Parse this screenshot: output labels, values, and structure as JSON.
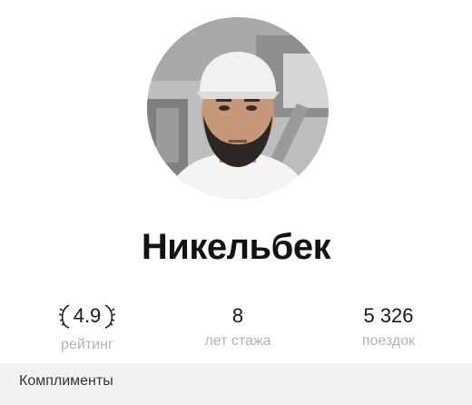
{
  "profile": {
    "name": "Никельбек",
    "avatar_icon": "driver-photo"
  },
  "stats": [
    {
      "value": "4.9",
      "label": "рейтинг",
      "decoration": "laurel-wreath-icon"
    },
    {
      "value": "8",
      "label": "лет стажа"
    },
    {
      "value": "5 326",
      "label": "поездок"
    }
  ],
  "sections": {
    "compliments_title": "Комплименты"
  },
  "colors": {
    "background": "#ffffff",
    "section_background": "#f2f2f2",
    "label_gray": "#b3b3b3",
    "text_dark": "#111111"
  }
}
